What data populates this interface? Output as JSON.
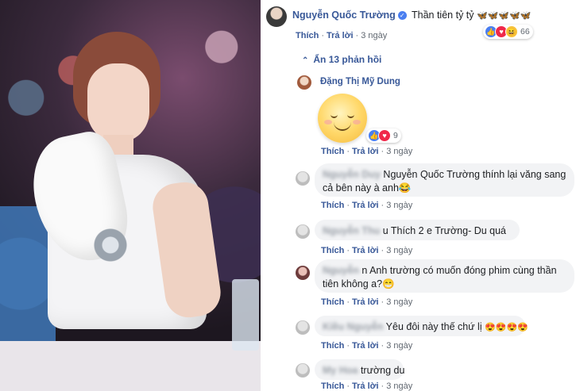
{
  "comments": [
    {
      "author": "Nguyễn Quốc Trường",
      "text": "Thần tiên tỷ tỷ",
      "emoji": "🦋🦋🦋🦋🦋",
      "actions": {
        "like": "Thích",
        "reply": "Trả lời",
        "time": "3 ngày"
      },
      "reaction_count": "66"
    }
  ],
  "hide_replies": "Ẩn 13 phản hồi",
  "replies": [
    {
      "author": "Đặng Thị Mỹ Dung",
      "text": "",
      "reaction_count": "9",
      "actions": {
        "like": "Thích",
        "reply": "Trả lời",
        "time": "3 ngày"
      }
    },
    {
      "author_blurred": "Nguyễn Duy",
      "text": "Nguyễn Quốc Trường thính lại văng sang cả bên này à anh😂",
      "actions": {
        "like": "Thích",
        "reply": "Trả lời",
        "time": "3 ngày"
      }
    },
    {
      "author_blurred": "Nguyễn Thu",
      "text": "u Thích 2 e Trường- Du quá",
      "actions": {
        "like": "Thích",
        "reply": "Trả lời",
        "time": "3 ngày"
      }
    },
    {
      "author_blurred": "Nguyễn",
      "text": "n Anh trường có muốn đóng phim cùng thần tiên không a?😁",
      "actions": {
        "like": "Thích",
        "reply": "Trả lời",
        "time": "3 ngày"
      }
    },
    {
      "author_blurred": "Kiều Nguyễn",
      "text": "Yêu đôi này thế chứ lị",
      "emoji": "😍😍😍😍",
      "actions": {
        "like": "Thích",
        "reply": "Trả lời",
        "time": "3 ngày"
      }
    },
    {
      "author_blurred": "My Hoa",
      "text": "trường du",
      "actions": {
        "like": "Thích",
        "reply": "Trả lời",
        "time": "3 ngày"
      }
    }
  ],
  "colors": {
    "name": "#385898",
    "bubble": "#f2f3f5",
    "like": "#4a7ef0",
    "love": "#f0284a"
  }
}
